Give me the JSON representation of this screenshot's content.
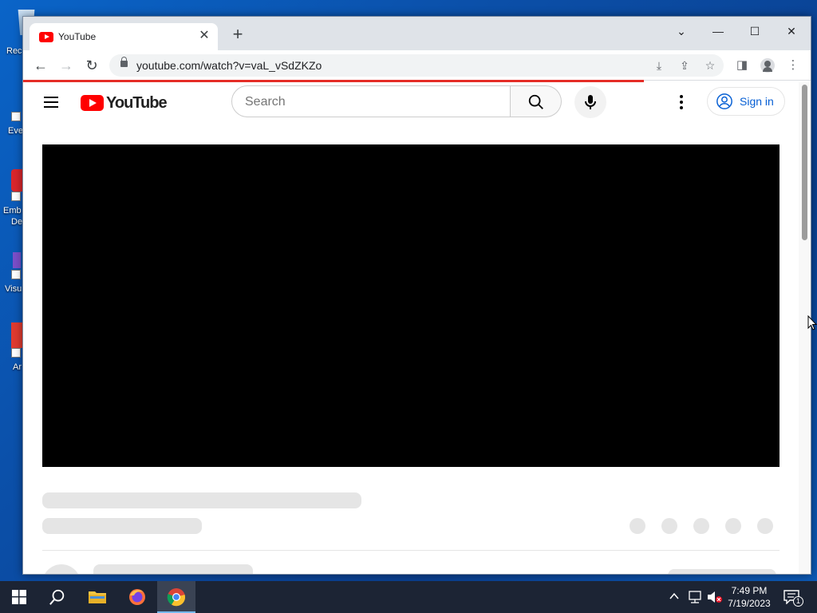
{
  "desktop": {
    "icons": [
      {
        "label": "Rec",
        "color": "#8fb7e0"
      },
      {
        "label": "Eve",
        "color": "#e8e8e8"
      },
      {
        "label": "Emb",
        "label2": "De",
        "color": "#d9262b"
      },
      {
        "label": "Visu",
        "color": "#7b4fc9"
      },
      {
        "label": "Ar",
        "color": "#e03a2f"
      }
    ]
  },
  "browser": {
    "tab": {
      "title": "YouTube"
    },
    "window_controls": {
      "tablist": "⌄",
      "minimize": "—",
      "maximize": "☐",
      "close": "✕"
    },
    "nav": {
      "back": "←",
      "forward": "→",
      "reload": "↻"
    },
    "address": {
      "url": "youtube.com/watch?v=vaL_vSdZKZo"
    },
    "toolbar_icons": {
      "install": "⤓",
      "share": "⇪",
      "bookmark": "☆",
      "side_panel": "◨",
      "profile": "●",
      "menu": "⋮"
    },
    "new_tab": "+"
  },
  "youtube": {
    "logo_text": "YouTube",
    "search": {
      "placeholder": "Search"
    },
    "sign_in": "Sign in",
    "accent": "#ff0000",
    "link_color": "#065fd4"
  },
  "taskbar": {
    "time": "7:49 PM",
    "date": "7/19/2023",
    "notification_count": "1"
  }
}
